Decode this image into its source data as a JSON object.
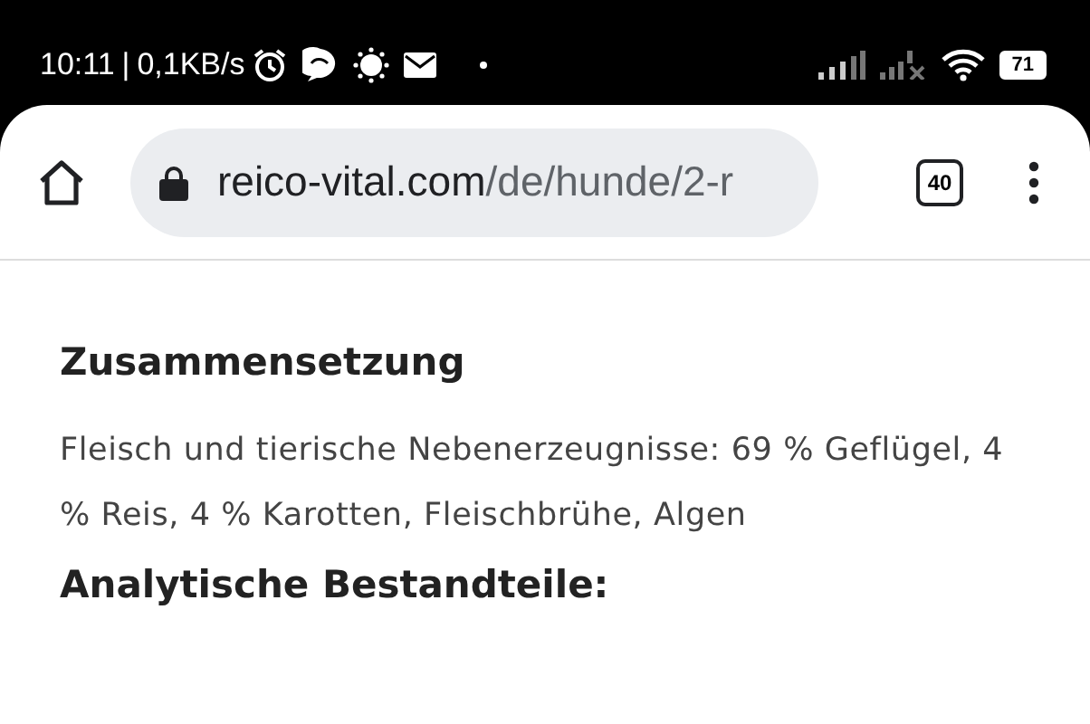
{
  "status_bar": {
    "time": "10:11",
    "separator": "|",
    "speed": "0,1KB/s",
    "battery": "71"
  },
  "browser": {
    "url_host": "reico-vital.com",
    "url_path": "/de/hunde/2-r",
    "tab_count": "40"
  },
  "content": [
    {
      "kind": "heading",
      "text": "Zusammensetzung"
    },
    {
      "kind": "paragraph",
      "text": "Fleisch und tierische Nebenerzeugnisse: 69 % Geflügel, 4 % Reis, 4 % Karotten, Fleischbrühe, Algen"
    },
    {
      "kind": "heading",
      "text": "Analytische Bestandteile:"
    }
  ]
}
